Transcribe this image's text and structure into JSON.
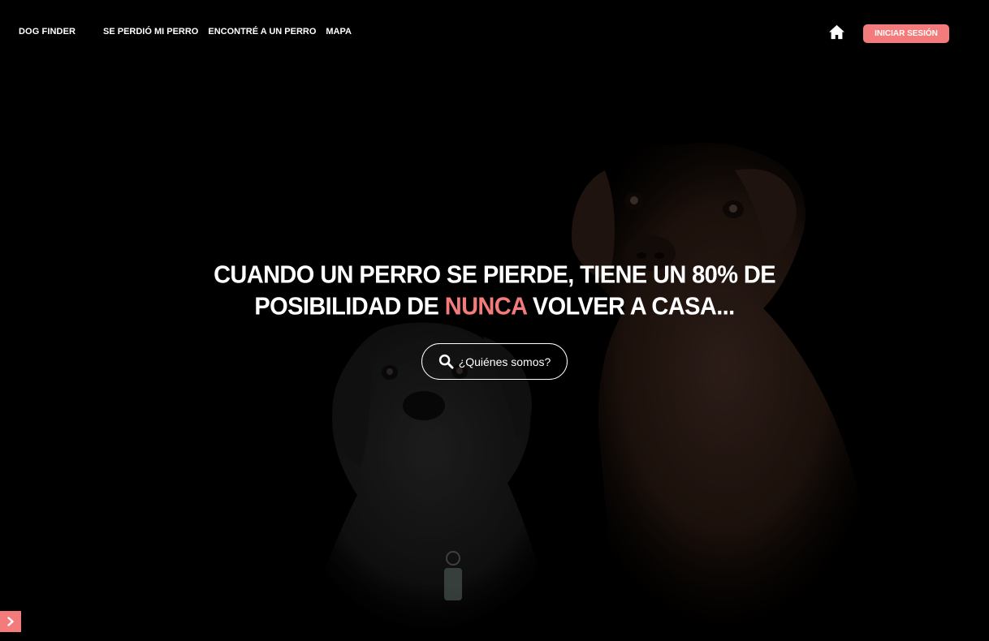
{
  "navbar": {
    "brand": "DOG FINDER",
    "links": [
      {
        "label": "SE PERDIÓ MI PERRO"
      },
      {
        "label": "ENCONTRÉ A UN PERRO"
      },
      {
        "label": "MAPA"
      }
    ],
    "home_icon": "home-icon",
    "login_label": "INICIAR SESIÓN"
  },
  "hero": {
    "headline_line1": "CUANDO UN PERRO SE PIERDE, TIENE UN 80% DE",
    "headline_line2_before": "POSIBILIDAD DE ",
    "headline_accent": "NUNCA",
    "headline_line2_after": " VOLVER A CASA...",
    "cta_label": "¿Quiénes somos?",
    "cta_icon": "search-icon"
  },
  "side_toggle_icon": "chevron-right-icon",
  "colors": {
    "accent": "#f47b7b",
    "background": "#000000",
    "text": "#ffffff"
  }
}
